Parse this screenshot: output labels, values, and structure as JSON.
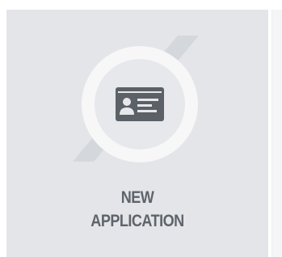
{
  "tile": {
    "label_line1": "NEW",
    "label_line2": "APPLICATION",
    "icon": "id-card-icon",
    "colors": {
      "tile_background": "#e3e5e8",
      "slash_shape": "#d4d7db",
      "icon_circle_ring": "#f7f7f8",
      "icon_circle_inner": "#e6e8eb",
      "icon_color": "#5c6168",
      "label_color": "#5f646b"
    }
  }
}
